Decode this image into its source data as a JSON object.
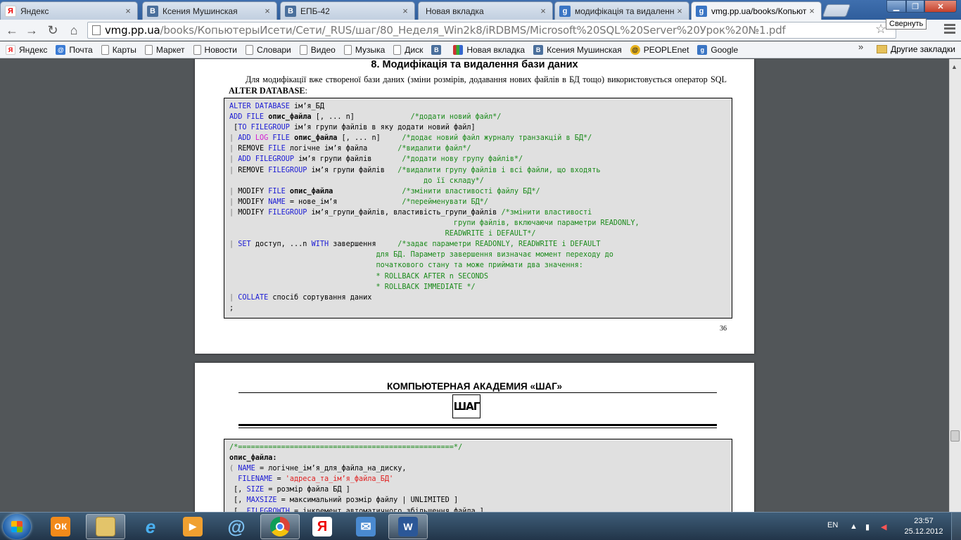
{
  "tabs": [
    {
      "title": "Яндекс",
      "favicon": "yandex-icon",
      "active": false
    },
    {
      "title": "Ксения Мушинская",
      "favicon": "vk-icon",
      "active": false
    },
    {
      "title": "ЕПБ-42",
      "favicon": "vk-icon",
      "active": false
    },
    {
      "title": "Новая вкладка",
      "favicon": "none",
      "active": false
    },
    {
      "title": "модифікація та видалення",
      "favicon": "google-icon",
      "active": false
    },
    {
      "title": "vmg.pp.ua/books/Копьют",
      "favicon": "google-icon",
      "active": true
    }
  ],
  "window": {
    "tooltip": "Свернуть"
  },
  "address": {
    "host": "vmg.pp.ua",
    "path": "/books/КопьютерыИсети/Сети/_RUS/шаг/80_Неделя_Win2k8/iRDBMS/Microsoft%20SQL%20Server%20Урок%20№1.pdf"
  },
  "bookmarks": [
    {
      "label": "Яндекс",
      "icon": "yandex-icon"
    },
    {
      "label": "Почта",
      "icon": "mail-icon"
    },
    {
      "label": "Карты",
      "icon": "page-icon"
    },
    {
      "label": "Маркет",
      "icon": "page-icon"
    },
    {
      "label": "Новости",
      "icon": "page-icon"
    },
    {
      "label": "Словари",
      "icon": "page-icon"
    },
    {
      "label": "Видео",
      "icon": "page-icon"
    },
    {
      "label": "Музыка",
      "icon": "page-icon"
    },
    {
      "label": "Диск",
      "icon": "page-icon"
    },
    {
      "label": "",
      "icon": "vk-icon"
    },
    {
      "label": "Новая вкладка",
      "icon": "flag-icon"
    },
    {
      "label": "Ксения Мушинская",
      "icon": "vk-icon"
    },
    {
      "label": "PEOPLEnet",
      "icon": "peoplenet-icon"
    },
    {
      "label": "Google",
      "icon": "google-icon"
    }
  ],
  "bookmarks_more": "»",
  "bookmarks_other": "Другие закладки",
  "page1": {
    "heading": "8. Модифікація та видалення бази даних",
    "paragraph_1": "Для модифікації вже створеної бази даних (зміни розмірів, додавання нових файлів в БД тощо) використовується оператор SQL ",
    "paragraph_bold": "ALTER DATABASE",
    "paragraph_2": ":",
    "page_number": "36"
  },
  "page2": {
    "academy": "КОМПЬЮТЕРНАЯ АКАДЕМИЯ «ШАГ»",
    "logo_text": "ШАГ"
  },
  "taskbar": {
    "apps": [
      {
        "name": "odnoklassniki-icon",
        "active": false
      },
      {
        "name": "file-explorer-icon",
        "active": true
      },
      {
        "name": "internet-explorer-icon",
        "active": false
      },
      {
        "name": "media-player-icon",
        "active": false
      },
      {
        "name": "email-client-icon",
        "active": false
      },
      {
        "name": "chrome-icon",
        "active": true
      },
      {
        "name": "yandex-browser-icon",
        "active": false
      },
      {
        "name": "mail-icon",
        "active": false
      },
      {
        "name": "word-icon",
        "active": true
      }
    ],
    "language": "EN",
    "time": "23:57",
    "date": "25.12.2012"
  }
}
